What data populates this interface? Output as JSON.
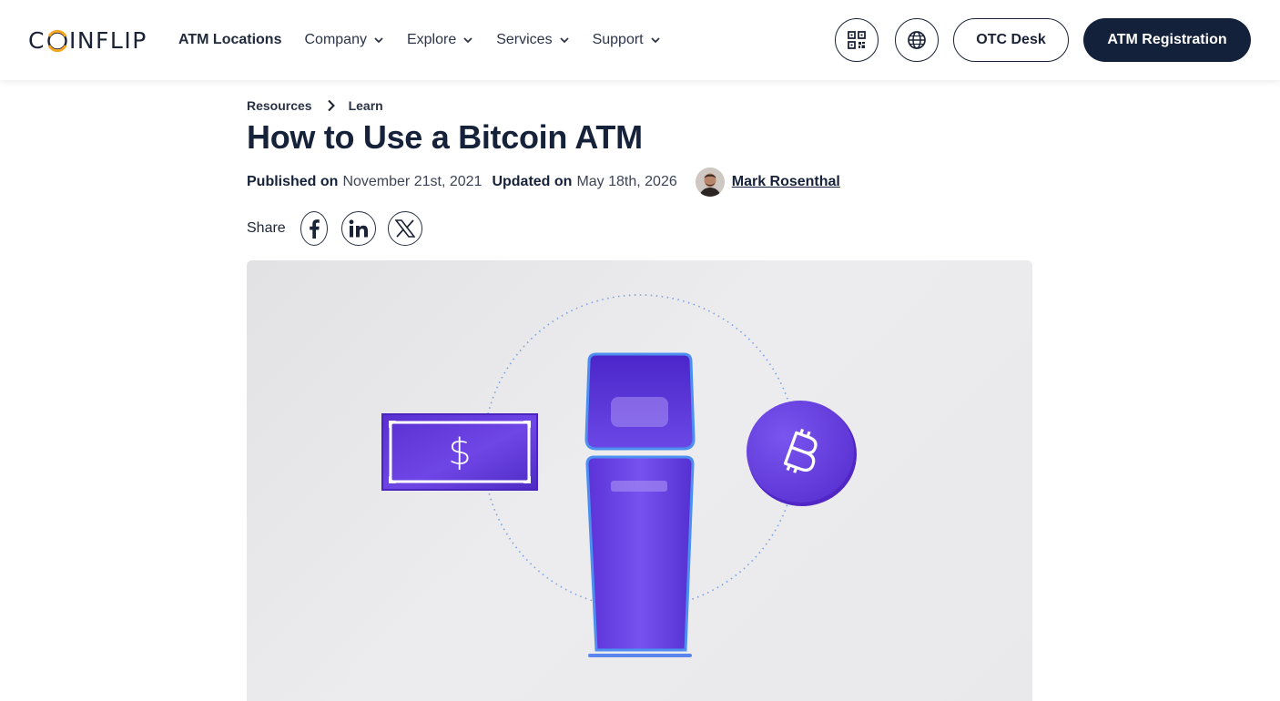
{
  "header": {
    "logo_text": {
      "pre": "C",
      "post": "INFLIP"
    },
    "nav": [
      {
        "label": "ATM Locations",
        "has_dropdown": false
      },
      {
        "label": "Company",
        "has_dropdown": true
      },
      {
        "label": "Explore",
        "has_dropdown": true
      },
      {
        "label": "Services",
        "has_dropdown": true
      },
      {
        "label": "Support",
        "has_dropdown": true
      }
    ],
    "qr_icon": "qr-code-icon",
    "language_icon": "globe-icon",
    "otc_label": "OTC Desk",
    "registration_label": "ATM Registration"
  },
  "breadcrumb": {
    "items": [
      "Resources",
      "Learn"
    ]
  },
  "article": {
    "title": "How to Use a Bitcoin ATM",
    "published_label": "Published on",
    "published_date": "November 21st, 2021",
    "updated_label": "Updated on",
    "updated_date": "May 18th, 2026",
    "author": "Mark Rosenthal"
  },
  "share": {
    "label": "Share",
    "icons": [
      "facebook-icon",
      "linkedin-icon",
      "x-icon"
    ]
  },
  "hero": {
    "icons": [
      "dollar-bill-icon",
      "atm-machine-icon",
      "bitcoin-coin-icon"
    ]
  },
  "colors": {
    "navy": "#14213a",
    "accent_purple": "#6d3fe0",
    "logo_orange": "#f5a623"
  }
}
